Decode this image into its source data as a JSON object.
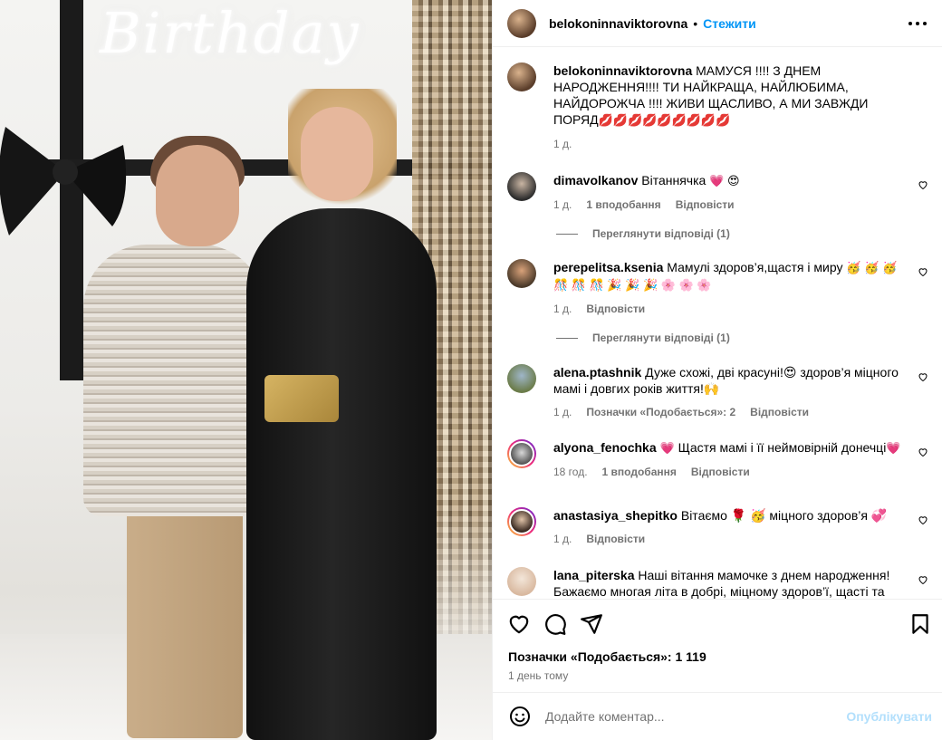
{
  "photo": {
    "neon_text": "Birthday"
  },
  "header": {
    "username": "belokoninnaviktorovna",
    "separator": "•",
    "follow_label": "Стежити",
    "more_icon": "more-horizontal-icon"
  },
  "caption": {
    "username": "belokoninnaviktorovna",
    "text": "МАМУСЯ !!!! З ДНЕМ НАРОДЖЕННЯ!!!! ТИ НАЙКРАЩА, НАЙЛЮБИМА, НАЙДОРОЖЧА !!!! ЖИВИ ЩАСЛИВО, А МИ ЗАВЖДИ ПОРЯД",
    "emoji": "💋💋💋💋💋💋💋💋💋",
    "time": "1 д."
  },
  "comments": [
    {
      "username": "dimavolkanov",
      "text": "Вітаннячка",
      "emoji": "💗 😍",
      "time": "1 д.",
      "likes": "1 вподобання",
      "reply": "Відповісти",
      "view_replies": "Переглянути відповіді (1)"
    },
    {
      "username": "perepelitsa.ksenia",
      "text": "Мамулі здоров’я,щастя і миру",
      "emoji": "🥳 🥳 🥳 🎊 🎊 🎊 🎉 🎉 🎉 🌸 🌸 🌸",
      "time": "1 д.",
      "reply": "Відповісти",
      "view_replies": "Переглянути відповіді (1)"
    },
    {
      "username": "alena.ptashnik",
      "text": "Дуже схожі, дві красуні!😍 здоров’я міцного мамі і довгих років життя!🙌",
      "time": "1 д.",
      "likes": "Позначки «Подобається»: 2",
      "reply": "Відповісти"
    },
    {
      "username": "alyona_fenochka",
      "text": "Щастя мамі і її неймовірній донечці",
      "emoji_before": "💗",
      "emoji": "💗",
      "time": "18 год.",
      "likes": "1 вподобання",
      "reply": "Відповісти"
    },
    {
      "username": "anastasiya_shepitko",
      "text": "Вітаємо 🌹 🥳 міцного здоров’я 💞",
      "time": "1 д.",
      "reply": "Відповісти"
    },
    {
      "username": "lana_piterska",
      "text": "Наші вітання мамочке з днем народження! Бажаємо многая літа в добрі, міцному здоров’ї, щасті та мирі!",
      "emoji": "💗 😍"
    }
  ],
  "actions": {
    "like_icon": "heart-icon",
    "comment_icon": "comment-icon",
    "share_icon": "send-icon",
    "save_icon": "bookmark-icon"
  },
  "likes_label": "Позначки «Подобається»: 1 119",
  "posted_time": "1 день тому",
  "composer": {
    "placeholder": "Додайте коментар...",
    "post_label": "Опублікувати",
    "emoji_icon": "smiley-icon"
  },
  "colors": {
    "accent": "#0095f6",
    "post_disabled": "#b2dffc",
    "muted": "#737373"
  }
}
